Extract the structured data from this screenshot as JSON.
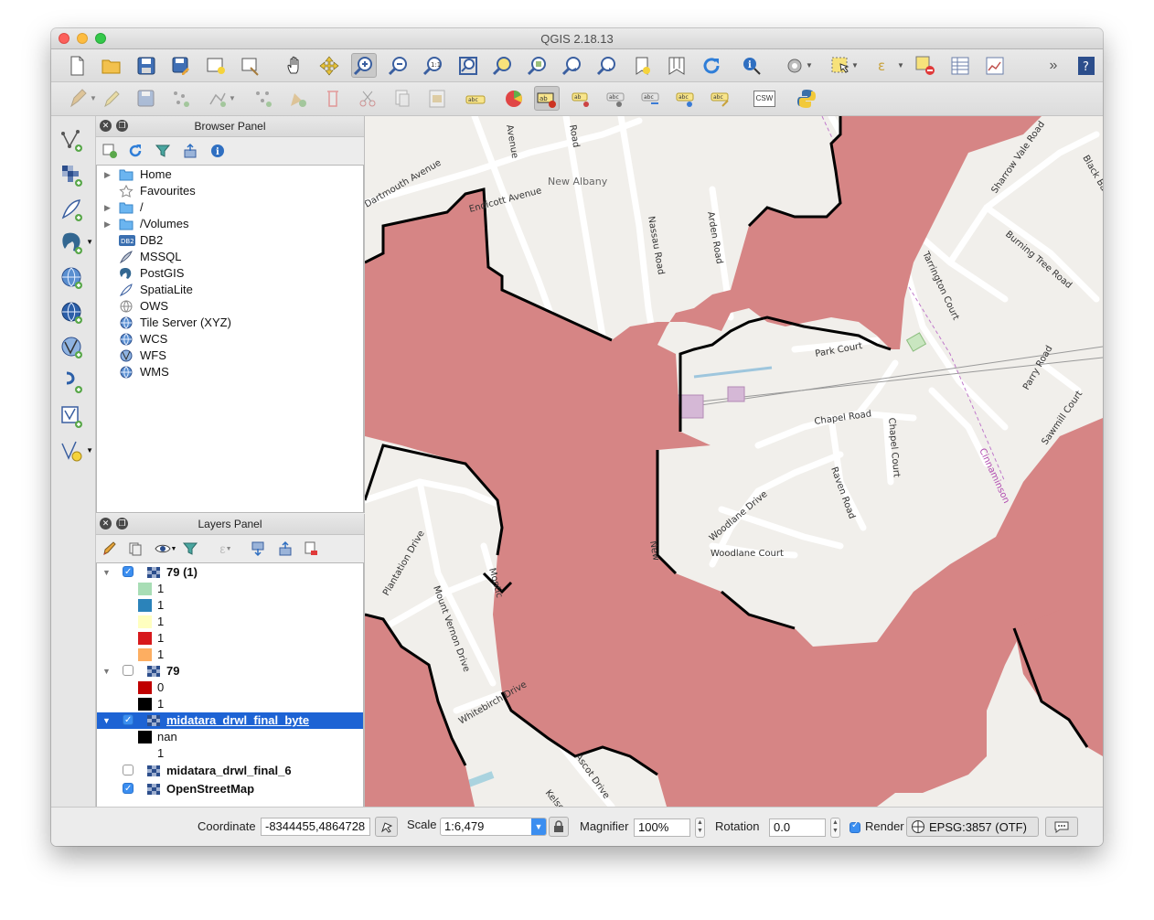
{
  "window": {
    "title": "QGIS 2.18.13"
  },
  "toolbar_main": {
    "icons": [
      "new-project-icon",
      "open-project-icon",
      "save-project-icon",
      "save-as-icon",
      "new-print-composer-icon",
      "composer-manager-icon",
      "pan-icon",
      "pan-to-selection-icon",
      "zoom-in-icon",
      "zoom-out-icon",
      "zoom-actual-icon",
      "zoom-full-icon",
      "zoom-to-selection-icon",
      "zoom-to-layer-icon",
      "zoom-last-icon",
      "zoom-next-icon",
      "new-bookmark-icon",
      "show-bookmarks-icon",
      "refresh-icon",
      "identify-icon",
      "action-icon",
      "select-icon",
      "measure-icon",
      "deselect-icon",
      "attribute-table-icon",
      "statistics-icon",
      "overflow-icon",
      "help-icon"
    ]
  },
  "toolbar_edit": {
    "icons": [
      "current-edits-icon",
      "toggle-editing-icon",
      "save-layer-edits-icon",
      "add-feature-icon",
      "move-feature-icon",
      "node-tool-icon",
      "delete-selected-icon",
      "cut-features-icon",
      "copy-features-icon",
      "paste-features-icon",
      "layer-labeling-icon",
      "diagram-icon",
      "label-pin-icon",
      "label-show-hide-icon",
      "label-move-icon",
      "label-rotate-icon",
      "label-change-icon",
      "csw-icon",
      "python-console-icon"
    ],
    "csw_label": "CSW"
  },
  "left_toolbar": {
    "icons": [
      "add-vector-layer-icon",
      "add-raster-layer-icon",
      "add-spatialite-layer-icon",
      "add-postgis-layer-icon",
      "add-wms-layer-icon",
      "add-wcs-layer-icon",
      "add-wfs-layer-icon",
      "add-delimited-text-icon",
      "add-virtual-layer-icon",
      "new-shapefile-icon"
    ]
  },
  "browser_panel": {
    "title": "Browser Panel",
    "items": [
      {
        "label": "Home",
        "icon": "folder-icon",
        "expandable": true
      },
      {
        "label": "Favourites",
        "icon": "star-icon",
        "expandable": false
      },
      {
        "label": "/",
        "icon": "folder-icon",
        "expandable": true
      },
      {
        "label": "/Volumes",
        "icon": "folder-icon",
        "expandable": true
      },
      {
        "label": "DB2",
        "icon": "db2-icon",
        "expandable": false
      },
      {
        "label": "MSSQL",
        "icon": "mssql-icon",
        "expandable": false
      },
      {
        "label": "PostGIS",
        "icon": "postgis-icon",
        "expandable": false
      },
      {
        "label": "SpatiaLite",
        "icon": "spatialite-icon",
        "expandable": false
      },
      {
        "label": "OWS",
        "icon": "ows-icon",
        "expandable": false
      },
      {
        "label": "Tile Server (XYZ)",
        "icon": "globe-icon",
        "expandable": false
      },
      {
        "label": "WCS",
        "icon": "wcs-icon",
        "expandable": false
      },
      {
        "label": "WFS",
        "icon": "wfs-icon",
        "expandable": false
      },
      {
        "label": "WMS",
        "icon": "wms-icon",
        "expandable": false
      }
    ]
  },
  "layers_panel": {
    "title": "Layers Panel",
    "layers": [
      {
        "name": "79 (1)",
        "checked": true,
        "expanded": true,
        "selected": false,
        "legend": [
          {
            "label": "1",
            "color": "#a8ddb5"
          },
          {
            "label": "1",
            "color": "#2b83ba"
          },
          {
            "label": "1",
            "color": "#ffffbf"
          },
          {
            "label": "1",
            "color": "#d7191c"
          },
          {
            "label": "1",
            "color": "#fdae61"
          }
        ]
      },
      {
        "name": "79",
        "checked": false,
        "expanded": true,
        "selected": false,
        "legend": [
          {
            "label": "0",
            "color": "#c00000"
          },
          {
            "label": "1",
            "color": "#000000"
          }
        ]
      },
      {
        "name": "midatara_drwl_final_byte",
        "checked": true,
        "expanded": true,
        "selected": true,
        "legend": [
          {
            "label": "nan",
            "color": "#000000"
          },
          {
            "label": "1",
            "color": "#ffffff"
          }
        ]
      },
      {
        "name": "midatara_drwl_final_6",
        "checked": false,
        "expanded": false,
        "selected": false,
        "legend": []
      },
      {
        "name": "OpenStreetMap",
        "checked": true,
        "expanded": false,
        "selected": false,
        "legend": []
      }
    ]
  },
  "map": {
    "labels": [
      "Dartmouth Avenue",
      "Endicott Avenue",
      "New Albany",
      "Nassau Road",
      "Arden Road",
      "Sharrow Vale Road",
      "Black Baron",
      "Burning Tree Road",
      "Tarrington Court",
      "Park Court",
      "Parry Road",
      "Chapel Road",
      "Chapel Court",
      "Sawmill Court",
      "Cinnaminson",
      "Raven Road",
      "Woodlane Drive",
      "Woodlane Court",
      "New",
      "Plantation Drive",
      "Mount Vernon Drive",
      "Montic",
      "Whitebirch Drive",
      "Ascot Drive",
      "Kelso",
      "Road",
      "Avenue"
    ],
    "flood_color": "#d98383",
    "land_color": "#f1efeb"
  },
  "statusbar": {
    "coordinate_label": "Coordinate",
    "coordinate_value": "-8344455,4864728",
    "scale_label": "Scale",
    "scale_value": "1:6,479",
    "magnifier_label": "Magnifier",
    "magnifier_value": "100%",
    "rotation_label": "Rotation",
    "rotation_value": "0.0",
    "render_label": "Render",
    "render_checked": true,
    "crs_value": "EPSG:3857 (OTF)"
  }
}
